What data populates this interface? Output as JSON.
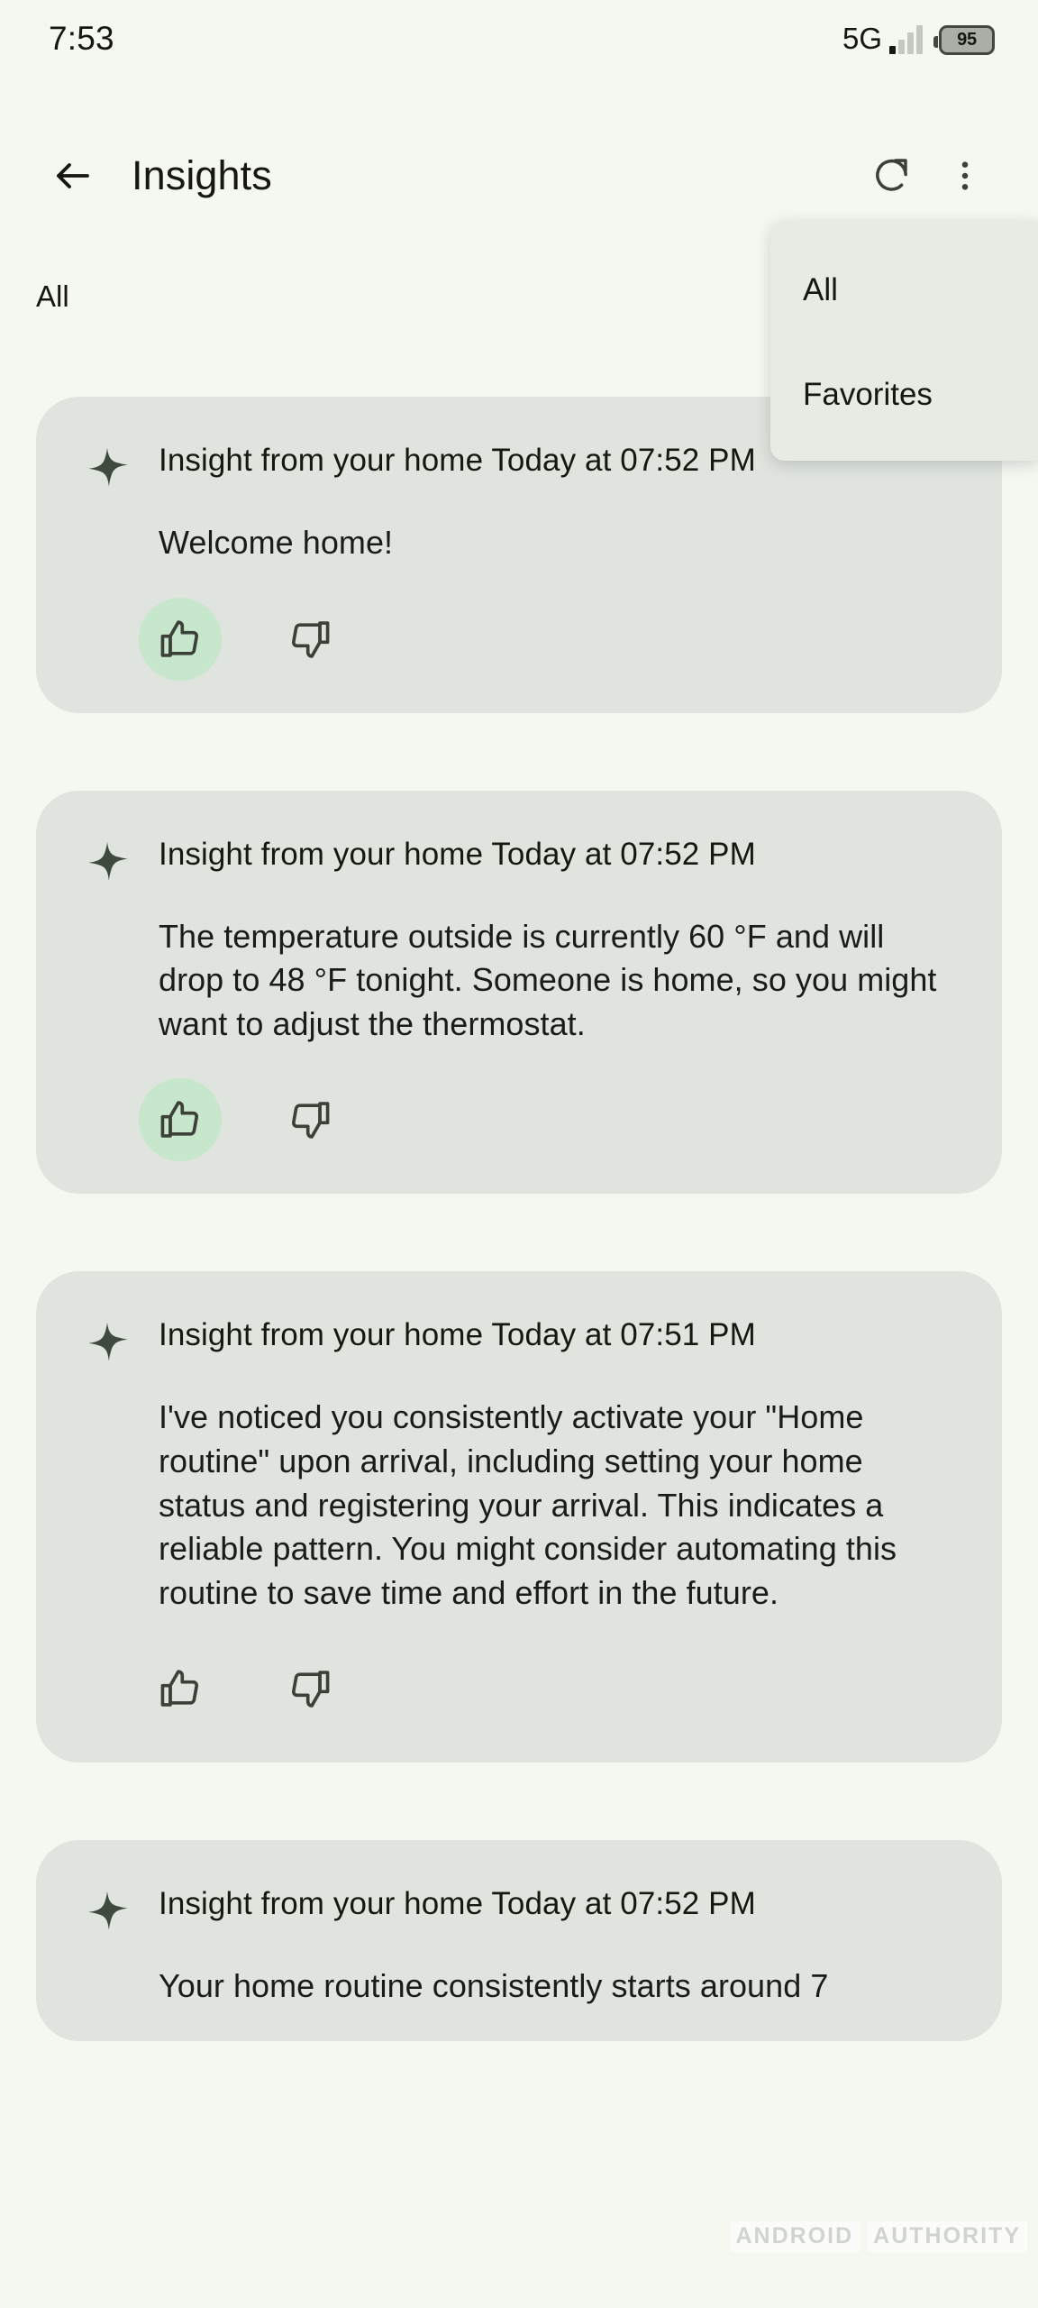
{
  "status_bar": {
    "time": "7:53",
    "network_type": "5G",
    "signal_icon": "signal-bars-icon",
    "signal_bars_total": 4,
    "signal_bars_active": 1,
    "battery_level": "95",
    "battery_icon": "battery-icon"
  },
  "app_bar": {
    "back_icon": "back-arrow-icon",
    "title": "Insights",
    "refresh_icon": "refresh-icon",
    "overflow_icon": "more-vertical-icon"
  },
  "filter": {
    "current": "All"
  },
  "menu": {
    "items": [
      {
        "label": "All"
      },
      {
        "label": "Favorites"
      }
    ]
  },
  "cards": [
    {
      "sparkle_icon": "sparkle-icon",
      "title": "Insight from your home Today at 07:52 PM",
      "body": "Welcome home!",
      "thumbs_up_icon": "thumb-up-icon",
      "thumbs_down_icon": "thumb-down-icon",
      "thumbs_up_selected": true,
      "thumbs_down_selected": false
    },
    {
      "sparkle_icon": "sparkle-icon",
      "title": "Insight from your home Today at 07:52 PM",
      "body": "The temperature outside is currently 60 °F and will drop to 48 °F tonight. Someone is home, so you might want to adjust the thermostat.",
      "thumbs_up_icon": "thumb-up-icon",
      "thumbs_down_icon": "thumb-down-icon",
      "thumbs_up_selected": true,
      "thumbs_down_selected": false
    },
    {
      "sparkle_icon": "sparkle-icon",
      "title": "Insight from your home Today at 07:51 PM",
      "body": "I've noticed you consistently activate your \"Home routine\" upon arrival, including setting your home status and registering your arrival. This indicates a reliable pattern. You might consider automating this routine to save time and effort in the future.",
      "thumbs_up_icon": "thumb-up-icon",
      "thumbs_down_icon": "thumb-down-icon",
      "thumbs_up_selected": false,
      "thumbs_down_selected": false
    },
    {
      "sparkle_icon": "sparkle-icon",
      "title": "Insight from your home Today at 07:52 PM",
      "body": "Your home routine consistently starts around 7",
      "thumbs_up_icon": "thumb-up-icon",
      "thumbs_down_icon": "thumb-down-icon",
      "thumbs_up_selected": false,
      "thumbs_down_selected": false
    }
  ],
  "watermark": {
    "part1": "ANDROID",
    "part2": "AUTHORITY"
  },
  "colors": {
    "page_background": "#f4f8f1",
    "card_background": "#dfe4de",
    "menu_background": "#e6ebe4",
    "accent_selected": "#c6e7cb",
    "text_primary": "#16180f",
    "icon_color": "#43483f"
  }
}
